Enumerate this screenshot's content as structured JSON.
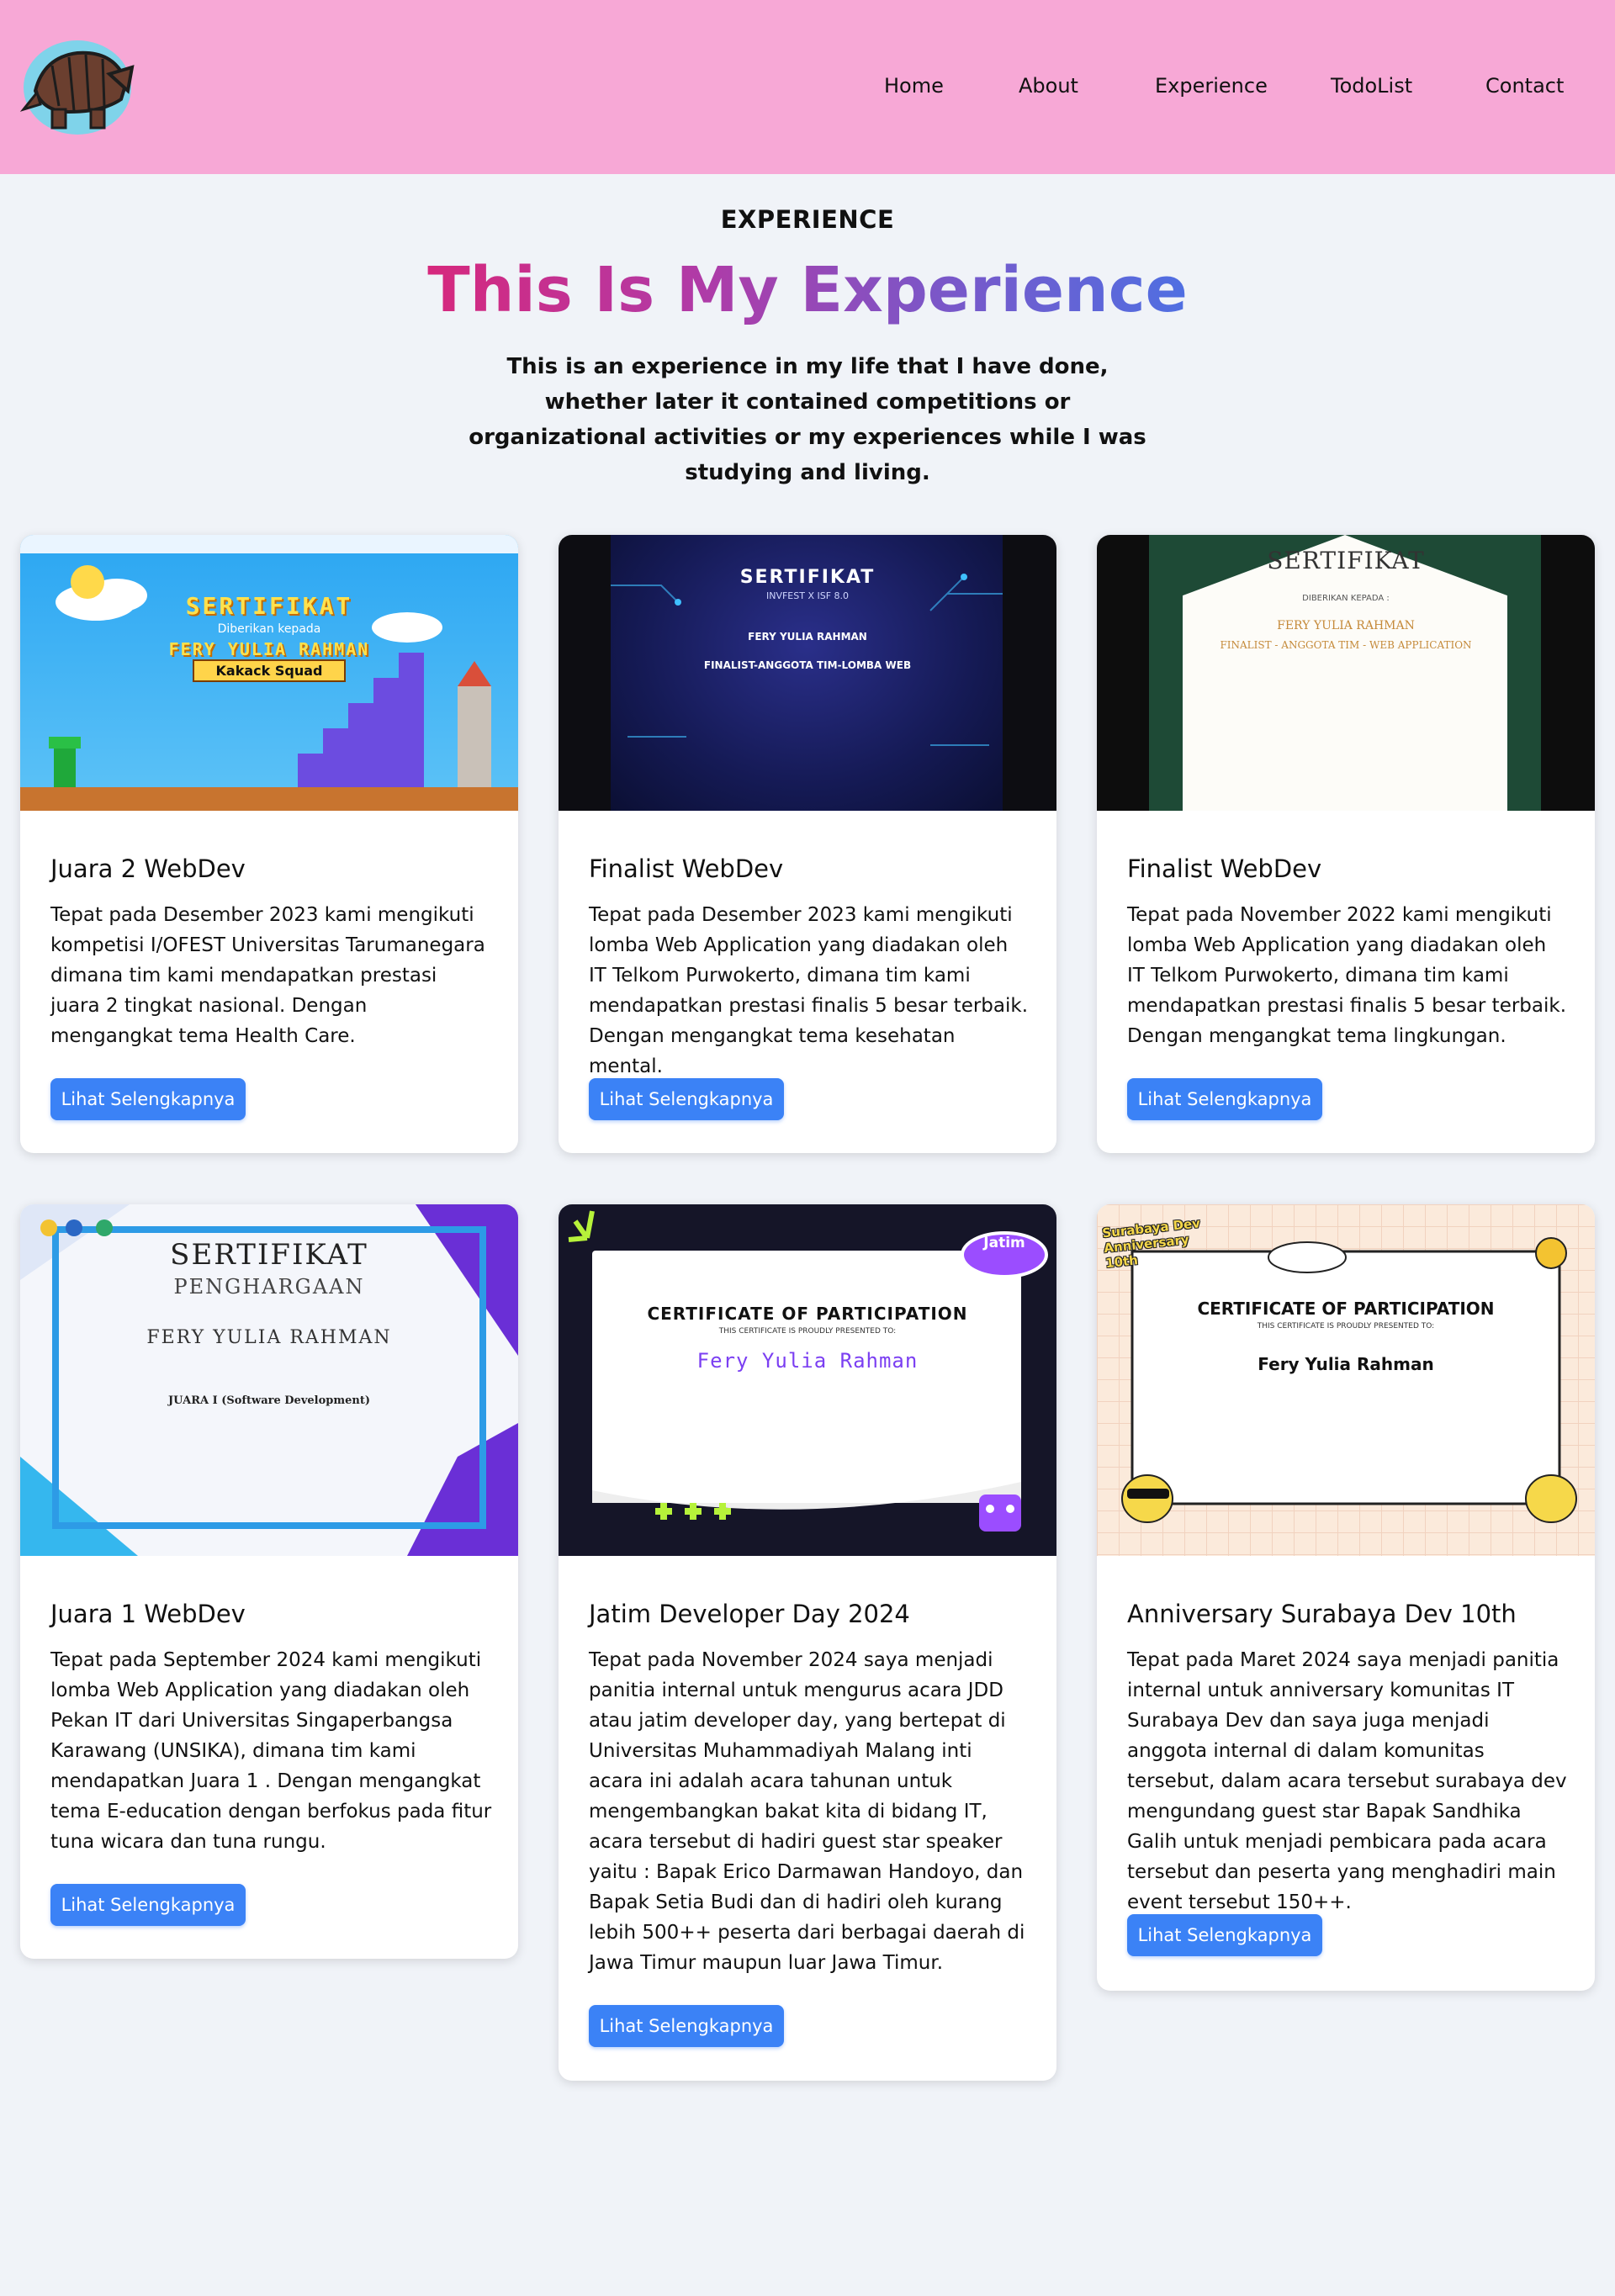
{
  "header": {
    "logo_icon": "armadillo-logo-icon",
    "nav": [
      "Home",
      "About",
      "Experience",
      "TodoList",
      "Contact"
    ]
  },
  "hero": {
    "eyebrow": "EXPERIENCE",
    "title": "This Is My Experience",
    "intro": "This is an experience in my life that I have done, whether later it contained competitions or organizational activities or my experiences while I was studying and living."
  },
  "cards": [
    {
      "title": "Juara 2 WebDev",
      "text": "Tepat pada Desember 2023 kami mengikuti kompetisi I/OFEST Universitas Tarumanegara dimana tim kami mendapatkan prestasi juara 2 tingkat nasional. Dengan mengangkat tema Health Care.",
      "button": "Lihat Selengkapnya",
      "image": {
        "heading": "SERTIFIKAT",
        "sub": "Diberikan kepada",
        "name": "FERY YULIA RAHMAN",
        "team": "Kakack Squad"
      }
    },
    {
      "title": "Finalist WebDev",
      "text": "Tepat pada Desember 2023 kami mengikuti lomba Web Application yang diadakan oleh IT Telkom Purwokerto, dimana tim kami mendapatkan prestasi finalis 5 besar terbaik. Dengan mengangkat tema kesehatan mental.",
      "button": "Lihat Selengkapnya",
      "image": {
        "heading": "SERTIFIKAT",
        "sub": "INVFEST X ISF 8.0",
        "name": "FERY YULIA RAHMAN",
        "team": "FINALIST-ANGGOTA TIM-LOMBA WEB"
      }
    },
    {
      "title": "Finalist WebDev",
      "text": "Tepat pada November 2022 kami mengikuti lomba Web Application yang diadakan oleh IT Telkom Purwokerto, dimana tim kami mendapatkan prestasi finalis 5 besar terbaik. Dengan mengangkat tema lingkungan.",
      "button": "Lihat Selengkapnya",
      "image": {
        "heading": "SERTIFIKAT",
        "sub": "DIBERIKAN KEPADA :",
        "name": "FERY YULIA RAHMAN",
        "team": "FINALIST - ANGGOTA TIM - WEB APPLICATION"
      }
    },
    {
      "title": "Juara 1 WebDev",
      "text": "Tepat pada September 2024 kami mengikuti lomba Web Application yang diadakan oleh Pekan IT dari Universitas Singaperbangsa Karawang (UNSIKA), dimana tim kami mendapatkan Juara 1 . Dengan mengangkat tema E-education dengan berfokus pada fitur tuna wicara dan tuna rungu.",
      "button": "Lihat Selengkapnya",
      "image": {
        "heading": "SERTIFIKAT",
        "sub": "PENGHARGAAN",
        "name": "FERY YULIA RAHMAN",
        "team": "JUARA I (Software Development)"
      }
    },
    {
      "title": "Jatim Developer Day 2024",
      "text": "Tepat pada November 2024 saya menjadi panitia internal untuk mengurus acara JDD atau jatim developer day, yang bertepat di Universitas Muhammadiyah Malang inti acara ini adalah acara tahunan untuk mengembangkan bakat kita di bidang IT, acara tersebut di hadiri guest star speaker yaitu : Bapak Erico Darmawan Handoyo, dan Bapak Setia Budi dan di hadiri oleh kurang lebih 500++ peserta dari berbagai daerah di Jawa Timur maupun luar Jawa Timur.",
      "button": "Lihat Selengkapnya",
      "image": {
        "heading": "CERTIFICATE OF PARTICIPATION",
        "sub": "THIS CERTIFICATE IS PROUDLY PRESENTED TO:",
        "name": "Fery Yulia Rahman",
        "team": "Jatim"
      }
    },
    {
      "title": "Anniversary Surabaya Dev 10th",
      "text": "Tepat pada Maret 2024 saya menjadi panitia internal untuk anniversary komunitas IT Surabaya Dev dan saya juga menjadi anggota internal di dalam komunitas tersebut, dalam acara tersebut surabaya dev mengundang guest star Bapak Sandhika Galih untuk menjadi pembicara pada acara tersebut dan peserta yang menghadiri main event tersebut 150++.",
      "button": "Lihat Selengkapnya",
      "image": {
        "heading": "CERTIFICATE OF PARTICIPATION",
        "sub": "THIS CERTIFICATE IS PROUDLY PRESENTED TO:",
        "name": "Fery Yulia Rahman",
        "team": "Surabaya Dev Anniversary 10th"
      }
    }
  ]
}
